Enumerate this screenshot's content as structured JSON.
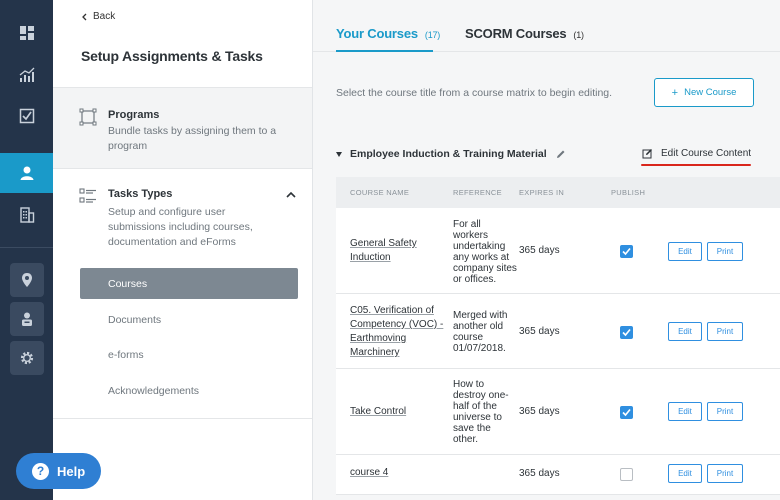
{
  "rail": {
    "icons": [
      "dashboard-icon",
      "analytics-icon",
      "tasks-icon",
      "user-icon",
      "building-icon",
      "location-icon",
      "person-card-icon",
      "settings-icon"
    ],
    "active": "user-icon"
  },
  "panel": {
    "back_label": "Back",
    "title": "Setup Assignments & Tasks",
    "programs": {
      "title": "Programs",
      "description": "Bundle tasks by assigning them to a program"
    },
    "task_types": {
      "title": "Tasks Types",
      "description": "Setup and configure user submissions including courses, documentation and eForms"
    },
    "sub_items": [
      {
        "label": "Courses",
        "active": true
      },
      {
        "label": "Documents",
        "active": false
      },
      {
        "label": "e-forms",
        "active": false
      },
      {
        "label": "Acknowledgements",
        "active": false
      }
    ]
  },
  "help": {
    "label": "Help",
    "icon": "?"
  },
  "tabs": [
    {
      "label": "Your Courses",
      "count": "(17)",
      "active": true
    },
    {
      "label": "SCORM Courses",
      "count": "(1)",
      "active": false
    }
  ],
  "hint": "Select the course title from a course matrix to begin editing.",
  "new_course_label": "New Course",
  "matrix": {
    "name": "Employee Induction & Training Material",
    "edit_content_label": "Edit Course Content"
  },
  "table": {
    "headers": [
      "COURSE NAME",
      "REFERENCE",
      "EXPIRES IN",
      "PUBLISH"
    ],
    "rows": [
      {
        "name_lines": [
          "General Safety",
          "Induction"
        ],
        "reference_lines": [
          "For all",
          "workers",
          "undertaking",
          "any works at",
          "company sites",
          "or offices."
        ],
        "expires": "365 days",
        "published": true
      },
      {
        "name_lines": [
          "C05. Verification of",
          "Competency (VOC) -",
          "Earthmoving",
          "Marchinery"
        ],
        "reference_lines": [
          "Merged with",
          "another old",
          "course",
          "01/07/2018."
        ],
        "expires": "365 days",
        "published": true
      },
      {
        "name_lines": [
          "Take Control"
        ],
        "reference_lines": [
          "How to",
          "destroy one-",
          "half of the",
          "universe to",
          "save the",
          "other."
        ],
        "expires": "365 days",
        "published": true
      },
      {
        "name_lines": [
          "course 4"
        ],
        "reference_lines": [],
        "expires": "365 days",
        "published": false
      }
    ],
    "edit_label": "Edit",
    "print_label": "Print"
  },
  "colors": {
    "accent": "#1a9ac9",
    "rail": "#24344a",
    "help": "#2f7fd3",
    "red_underline": "#d9261c"
  }
}
